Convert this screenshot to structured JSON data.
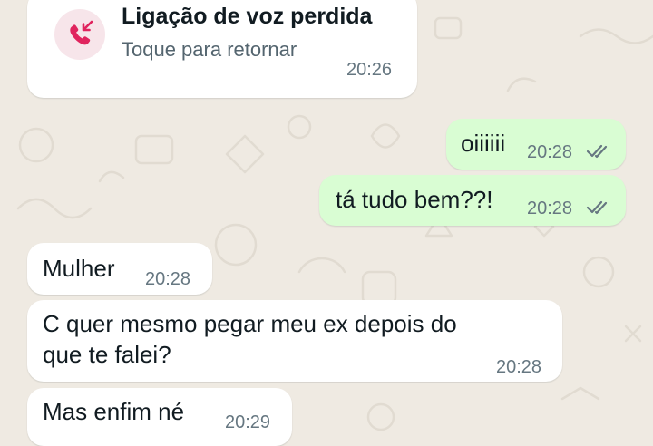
{
  "missed_call": {
    "title": "Ligação de voz perdida",
    "subtitle": "Toque para retornar",
    "time": "20:26",
    "icon": "missed-call-icon",
    "icon_color": "#e0245e"
  },
  "messages": [
    {
      "direction": "outgoing",
      "text": "oiiiiii",
      "time": "20:28",
      "status": "read-ticks"
    },
    {
      "direction": "outgoing",
      "text": "tá tudo bem??!",
      "time": "20:28",
      "status": "read-ticks"
    },
    {
      "direction": "incoming",
      "text": "Mulher",
      "time": "20:28"
    },
    {
      "direction": "incoming",
      "text": "C quer mesmo pegar meu ex depois do\nque te falei?",
      "time": "20:28"
    },
    {
      "direction": "incoming",
      "text": "Mas enfim né",
      "time": "20:29"
    }
  ],
  "colors": {
    "chat_background": "#efeae2",
    "incoming_bubble": "#ffffff",
    "outgoing_bubble": "#d9fdd3",
    "timestamp": "#667781",
    "tick": "#667781"
  }
}
